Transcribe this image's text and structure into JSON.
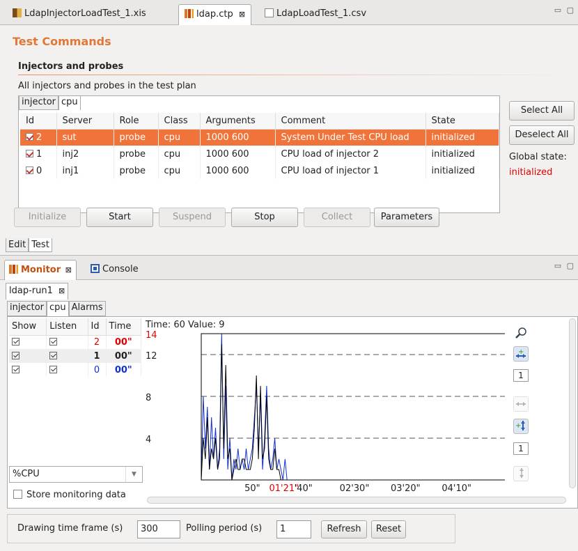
{
  "editor_tabs": [
    {
      "label": "LdapInjectorLoadTest_1.xis"
    },
    {
      "label": "ldap.ctp",
      "close": "⊠"
    },
    {
      "label": "LdapLoadTest_1.csv"
    }
  ],
  "editor": {
    "title": "Test Commands",
    "section": "Injectors and probes",
    "subtitle": "All injectors and probes in the test plan",
    "filter_tabs": [
      "injector",
      "cpu"
    ],
    "columns": [
      "Id",
      "Server",
      "Role",
      "Class",
      "Arguments",
      "Comment",
      "State"
    ],
    "rows": [
      {
        "id": "2",
        "server": "sut",
        "role": "probe",
        "class": "cpu",
        "args": "1000 600",
        "comment": "System Under Test CPU load",
        "state": "initialized"
      },
      {
        "id": "1",
        "server": "inj2",
        "role": "probe",
        "class": "cpu",
        "args": "1000 600",
        "comment": "CPU load of injector 2",
        "state": "initialized"
      },
      {
        "id": "0",
        "server": "inj1",
        "role": "probe",
        "class": "cpu",
        "args": "1000 600",
        "comment": "CPU load of injector 1",
        "state": "initialized"
      }
    ],
    "select_all": "Select All",
    "deselect_all": "Deselect All",
    "global_state_label": "Global state:",
    "global_state_value": "initialized",
    "buttons": {
      "initialize": "Initialize",
      "start": "Start",
      "suspend": "Suspend",
      "stop": "Stop",
      "collect": "Collect",
      "parameters": "Parameters"
    },
    "bottom_tabs": [
      "Edit",
      "Test"
    ]
  },
  "monitor": {
    "tabs": [
      {
        "label": "Monitor",
        "close": "⊠"
      },
      {
        "label": "Console"
      }
    ],
    "run_tab": "ldap-run1",
    "run_close": "⊠",
    "class_tabs": [
      "injector",
      "cpu",
      "Alarms"
    ],
    "columns": [
      "Show",
      "Listen",
      "Id",
      "Time"
    ],
    "rows": [
      {
        "id": "2",
        "time": "00\"",
        "color": "#e00000"
      },
      {
        "id": "1",
        "time": "00\"",
        "color": "#000000"
      },
      {
        "id": "0",
        "time": "00\"",
        "color": "#1030d0"
      }
    ],
    "metric": "%CPU",
    "store_label": "Store monitoring data",
    "chart_header": "Time: 60 Value: 9",
    "zoom_x_value": "1",
    "zoom_y_value": "1",
    "drawing_label": "Drawing time frame (s)",
    "drawing_value": "300",
    "polling_label": "Polling period (s)",
    "polling_value": "1",
    "refresh": "Refresh",
    "reset": "Reset"
  },
  "chart_data": {
    "type": "line",
    "header": "Time: 60 Value: 9",
    "y_ticks": [
      "4",
      "8",
      "12",
      "14"
    ],
    "y_tick_values": [
      4,
      8,
      12,
      14
    ],
    "y_max_highlight": "14",
    "ylim": [
      0,
      14
    ],
    "x_ticks": [
      "50\"",
      "01'21\"",
      "'40\"",
      "02'30\"",
      "03'20\"",
      "04'10\""
    ],
    "x_tick_values": [
      50,
      81,
      100,
      150,
      200,
      250
    ],
    "xlim": [
      0,
      300
    ],
    "dashed_levels": [
      4,
      8,
      12,
      14
    ],
    "series": [
      {
        "name": "0",
        "color": "#1030d0",
        "x": [
          0,
          2,
          4,
          6,
          8,
          10,
          12,
          14,
          16,
          18,
          20,
          22,
          24,
          26,
          28,
          30,
          32,
          34,
          36,
          38,
          40,
          42,
          44,
          46,
          48,
          50,
          52,
          54,
          56,
          58,
          60,
          62,
          64,
          66,
          68,
          70,
          72,
          74,
          76,
          78,
          80,
          82,
          84
        ],
        "y": [
          0,
          8,
          3,
          7,
          1,
          6,
          2,
          5,
          1,
          3,
          14,
          2,
          9,
          1,
          4,
          0,
          2,
          1,
          3,
          1,
          2,
          1,
          3,
          1,
          2,
          3,
          6,
          9,
          3,
          8,
          1,
          4,
          9,
          3,
          1,
          2,
          4,
          1,
          2,
          1,
          0,
          2,
          0
        ]
      },
      {
        "name": "1",
        "color": "#000000",
        "x": [
          0,
          2,
          4,
          6,
          8,
          10,
          12,
          14,
          16,
          18,
          20,
          22,
          24,
          26,
          28,
          30,
          32,
          34,
          36,
          38,
          40,
          42,
          44,
          46,
          48,
          50,
          52,
          54,
          56,
          58,
          60,
          62,
          64,
          66,
          68,
          70,
          72,
          74,
          76,
          78,
          80
        ],
        "y": [
          0,
          4,
          2,
          6,
          1,
          3,
          2,
          4,
          1,
          2,
          13,
          3,
          11,
          2,
          3,
          0,
          1,
          2,
          1,
          1,
          2,
          2,
          1,
          1,
          1,
          2,
          5,
          10,
          2,
          9,
          2,
          3,
          8,
          2,
          1,
          1,
          3,
          1,
          1,
          0,
          0
        ]
      }
    ]
  }
}
